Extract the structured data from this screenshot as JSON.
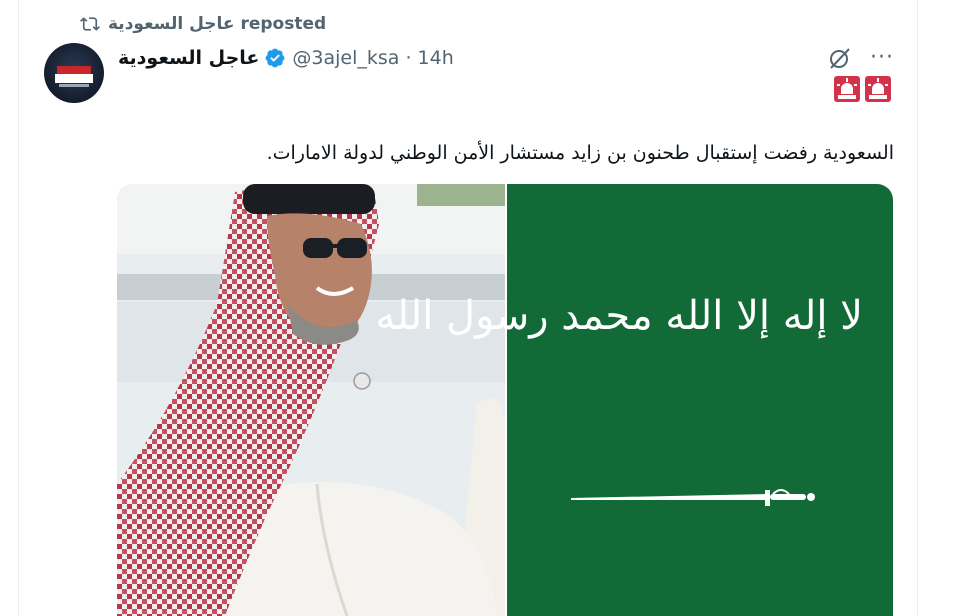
{
  "repost": {
    "icon": "repost-icon",
    "text": "عاجل السعودية reposted"
  },
  "author": {
    "display_name": "عاجل السعودية",
    "verified": true,
    "handle_time": "@3ajel_ksa · 14h",
    "avatar_icon": "account-avatar"
  },
  "actions": {
    "grok_icon": "grok-icon",
    "more_label": "···"
  },
  "badges": [
    "rotating-light-emoji",
    "rotating-light-emoji"
  ],
  "tweet": {
    "text": "السعودية رفضت إستقبال طحنون بن زايد مستشار الأمن الوطني لدولة الامارات."
  },
  "media": {
    "left_image": "photo of man in keffiyeh with sunglasses",
    "right_image": "saudi-flag",
    "flag_text": "لا إله إلا الله محمد رسول الله"
  },
  "colors": {
    "verified_blue": "#1d9bf0",
    "flag_green": "#126b36",
    "siren_red": "#d2334b",
    "muted_text": "#536471"
  }
}
